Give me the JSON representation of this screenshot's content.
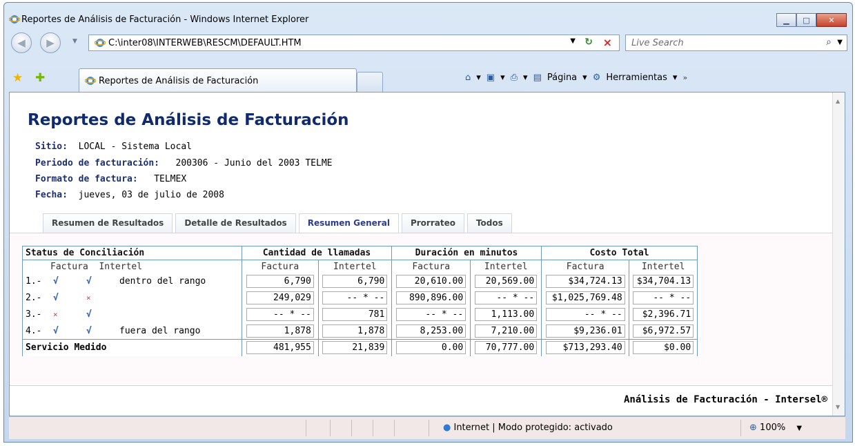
{
  "window": {
    "title": "Reportes de Análisis de Facturación - Windows Internet Explorer",
    "minimize_icon": "minimize-icon",
    "maximize_icon": "maximize-icon",
    "close_icon": "close-icon"
  },
  "nav": {
    "address": "C:\\inter08\\INTERWEB\\RESCM\\DEFAULT.HTM",
    "search_placeholder": "Live Search"
  },
  "browser_tab": {
    "label": "Reportes de Análisis de Facturación"
  },
  "commands": {
    "page": "Página",
    "tools": "Herramientas"
  },
  "report": {
    "title": "Reportes de Análisis de Facturación",
    "site_label": "Sitio:",
    "site_value": "LOCAL - Sistema Local",
    "period_label": "Periodo de facturación:",
    "period_value": "200306 - Junio del 2003 TELME",
    "format_label": "Formato de factura:",
    "format_value": "TELMEX",
    "date_label": "Fecha:",
    "date_value": "jueves, 03 de julio de 2008"
  },
  "tabs": [
    {
      "label": "Resumen de Resultados"
    },
    {
      "label": "Detalle de Resultados"
    },
    {
      "label": "Resumen General"
    },
    {
      "label": "Prorrateo"
    },
    {
      "label": "Todos"
    }
  ],
  "table": {
    "headers": [
      "Status de Conciliación",
      "Cantidad de llamadas",
      "Duración en minutos",
      "Costo Total"
    ],
    "sub_status_factura": "Factura",
    "sub_status_intertel": "Intertel",
    "sub_factura": "Factura",
    "sub_intertel": "Intertel",
    "rows": [
      {
        "num": "1.-",
        "factura": "√",
        "intertel": "√",
        "desc": "dentro del rango",
        "values": [
          "6,790",
          "6,790",
          "20,610.00",
          "20,569.00",
          "$34,724.13",
          "$34,704.13"
        ]
      },
      {
        "num": "2.-",
        "factura": "√",
        "intertel": "×",
        "desc": "",
        "values": [
          "249,029",
          "-- * --",
          "890,896.00",
          "-- * --",
          "$1,025,769.48",
          "-- * --"
        ]
      },
      {
        "num": "3.-",
        "factura": "×",
        "intertel": "√",
        "desc": "",
        "values": [
          "-- * --",
          "781",
          "-- * --",
          "1,113.00",
          "-- * --",
          "$2,396.71"
        ]
      },
      {
        "num": "4.-",
        "factura": "√",
        "intertel": "√",
        "desc": "fuera del rango",
        "values": [
          "1,878",
          "1,878",
          "8,253.00",
          "7,210.00",
          "$9,236.01",
          "$6,972.57"
        ]
      }
    ],
    "total_label": "Servicio Medido",
    "total_values": [
      "481,955",
      "21,839",
      "0.00",
      "70,777.00",
      "$713,293.40",
      "$0.00"
    ]
  },
  "footer": "Análisis de Facturación - Intersel®",
  "status": {
    "zone": "Internet | Modo protegido: activado",
    "zoom": "100%"
  },
  "colors": {
    "title": "#102a6e",
    "table_border": "#6a98c7",
    "check": "#2a5fc8",
    "cross": "#d33b3b"
  }
}
